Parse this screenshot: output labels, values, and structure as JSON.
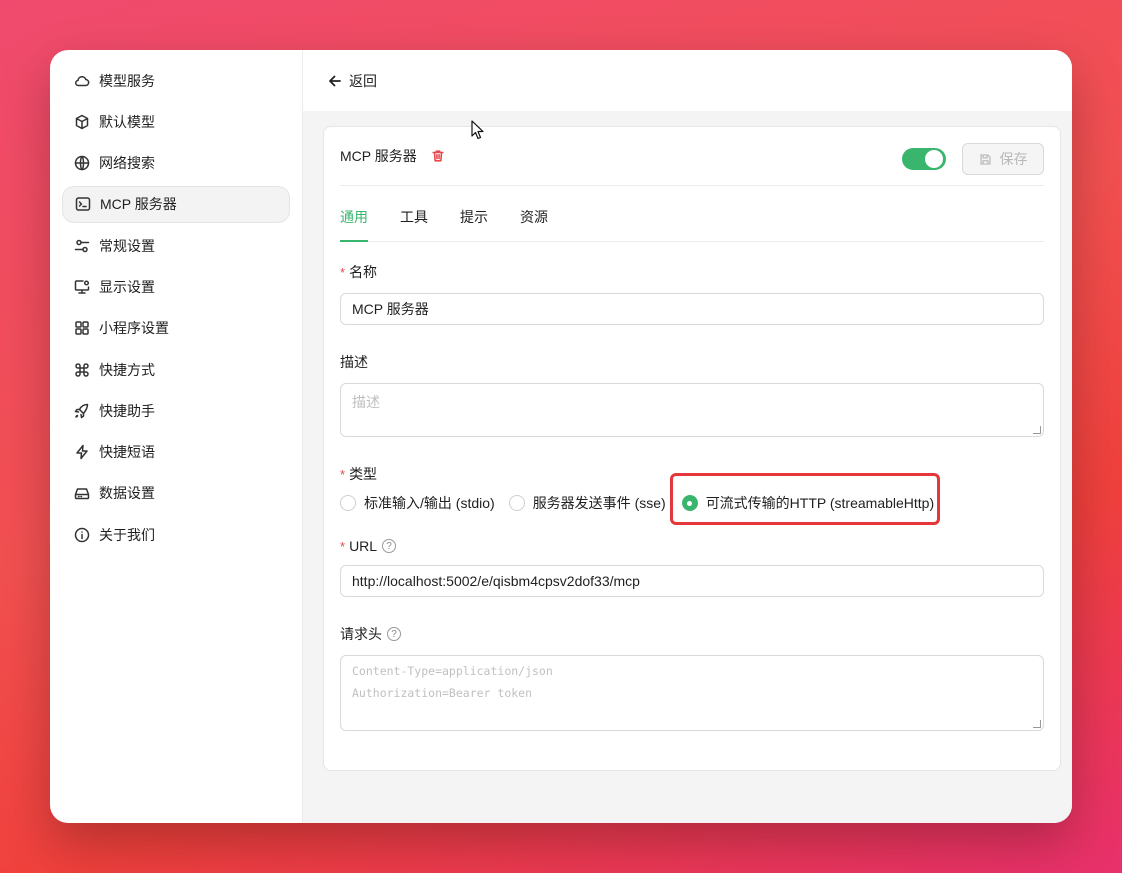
{
  "sidebar": {
    "items": [
      {
        "label": "模型服务",
        "icon": "cloud-icon"
      },
      {
        "label": "默认模型",
        "icon": "cube-icon"
      },
      {
        "label": "网络搜索",
        "icon": "globe-icon"
      },
      {
        "label": "MCP 服务器",
        "icon": "terminal-icon",
        "active": true
      },
      {
        "label": "常规设置",
        "icon": "sliders-icon"
      },
      {
        "label": "显示设置",
        "icon": "monitor-gear-icon"
      },
      {
        "label": "小程序设置",
        "icon": "grid-icon"
      },
      {
        "label": "快捷方式",
        "icon": "command-icon"
      },
      {
        "label": "快捷助手",
        "icon": "rocket-icon"
      },
      {
        "label": "快捷短语",
        "icon": "zap-icon"
      },
      {
        "label": "数据设置",
        "icon": "hard-drive-icon"
      },
      {
        "label": "关于我们",
        "icon": "info-icon"
      }
    ]
  },
  "topbar": {
    "back_label": "返回"
  },
  "card": {
    "title": "MCP 服务器",
    "enabled": true,
    "save_label": "保存",
    "tabs": [
      "通用",
      "工具",
      "提示",
      "资源"
    ],
    "active_tab": "通用",
    "name": {
      "label": "名称",
      "value": "MCP 服务器"
    },
    "description": {
      "label": "描述",
      "placeholder": "描述"
    },
    "type": {
      "label": "类型",
      "options": [
        "标准输入/输出 (stdio)",
        "服务器发送事件 (sse)",
        "可流式传输的HTTP (streamableHttp)"
      ],
      "selected": "可流式传输的HTTP (streamableHttp)"
    },
    "url": {
      "label": "URL",
      "value": "http://localhost:5002/e/qisbm4cpsv2dof33/mcp"
    },
    "headers": {
      "label": "请求头",
      "placeholder_line1": "Content-Type=application/json",
      "placeholder_line2": "Authorization=Bearer token"
    }
  },
  "colors": {
    "accent": "#3ab56e",
    "danger": "#e5484d",
    "highlight": "#e5363b"
  }
}
